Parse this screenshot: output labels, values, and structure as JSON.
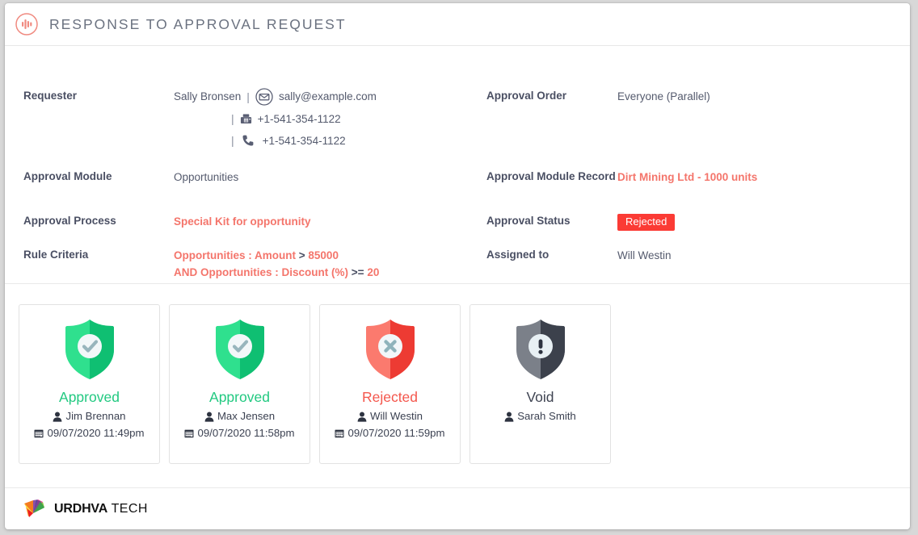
{
  "header": {
    "title": "RESPONSE TO APPROVAL REQUEST",
    "icon": "signal-bars-icon",
    "icon_color": "#f08a80"
  },
  "details": {
    "left": [
      {
        "label": "Requester",
        "type": "requester",
        "name": "Sally Bronsen",
        "separator": "|",
        "email": "sally@example.com",
        "email_icon": "envelope-circle-icon",
        "fax": "+1-541-354-1122",
        "fax_icon": "fax-icon",
        "phone": "+1-541-354-1122",
        "phone_icon": "phone-icon"
      },
      {
        "label": "Approval Module",
        "type": "text",
        "value": "Opportunities"
      },
      {
        "label": "Approval Process",
        "type": "accent",
        "value": "Special Kit for opportunity"
      },
      {
        "label": "Rule Criteria",
        "type": "criteria",
        "line1_field": "Opportunities : Amount",
        "line1_op": ">",
        "line1_value": "85000",
        "line2_prefix": "AND",
        "line2_field": "Opportunities : Discount (%)",
        "line2_op": ">=",
        "line2_value": "20"
      }
    ],
    "right": [
      {
        "label": "Approval Order",
        "type": "text",
        "value": "Everyone (Parallel)"
      },
      {
        "label": "Approval Module Record",
        "type": "accent",
        "value": "Dirt Mining Ltd - 1000 units"
      },
      {
        "label": "Approval Status",
        "type": "badge",
        "value": "Rejected",
        "badge_color": "#fb3b35",
        "badge_text_color": "#ffffff"
      },
      {
        "label": "Assigned to",
        "type": "text",
        "value": "Will Westin"
      }
    ]
  },
  "cards": [
    {
      "status": "Approved",
      "state": "approved",
      "icon": "shield-check-icon",
      "icon_color": "#1ecb7b",
      "status_color": "#22c981",
      "person": "Jim Brennan",
      "person_icon": "user-icon",
      "date": "09/07/2020 11:49pm",
      "date_icon": "calendar-icon"
    },
    {
      "status": "Approved",
      "state": "approved",
      "icon": "shield-check-icon",
      "icon_color": "#1ecb7b",
      "status_color": "#22c981",
      "person": "Max Jensen",
      "person_icon": "user-icon",
      "date": "09/07/2020 11:58pm",
      "date_icon": "calendar-icon"
    },
    {
      "status": "Rejected",
      "state": "rejected",
      "icon": "shield-x-icon",
      "icon_color": "#f4574d",
      "status_color": "#f4574d",
      "person": "Will Westin",
      "person_icon": "user-icon",
      "date": "09/07/2020 11:59pm",
      "date_icon": "calendar-icon"
    },
    {
      "status": "Void",
      "state": "void",
      "icon": "shield-exclamation-icon",
      "icon_color": "#3f4452",
      "status_color": "#3f4452",
      "person": "Sarah Smith",
      "person_icon": "user-icon",
      "date": "",
      "date_icon": ""
    }
  ],
  "footer": {
    "logo_icon": "urdhva-fan-logo",
    "brand_bold": "URDHVA",
    "brand_light": "TECH"
  }
}
